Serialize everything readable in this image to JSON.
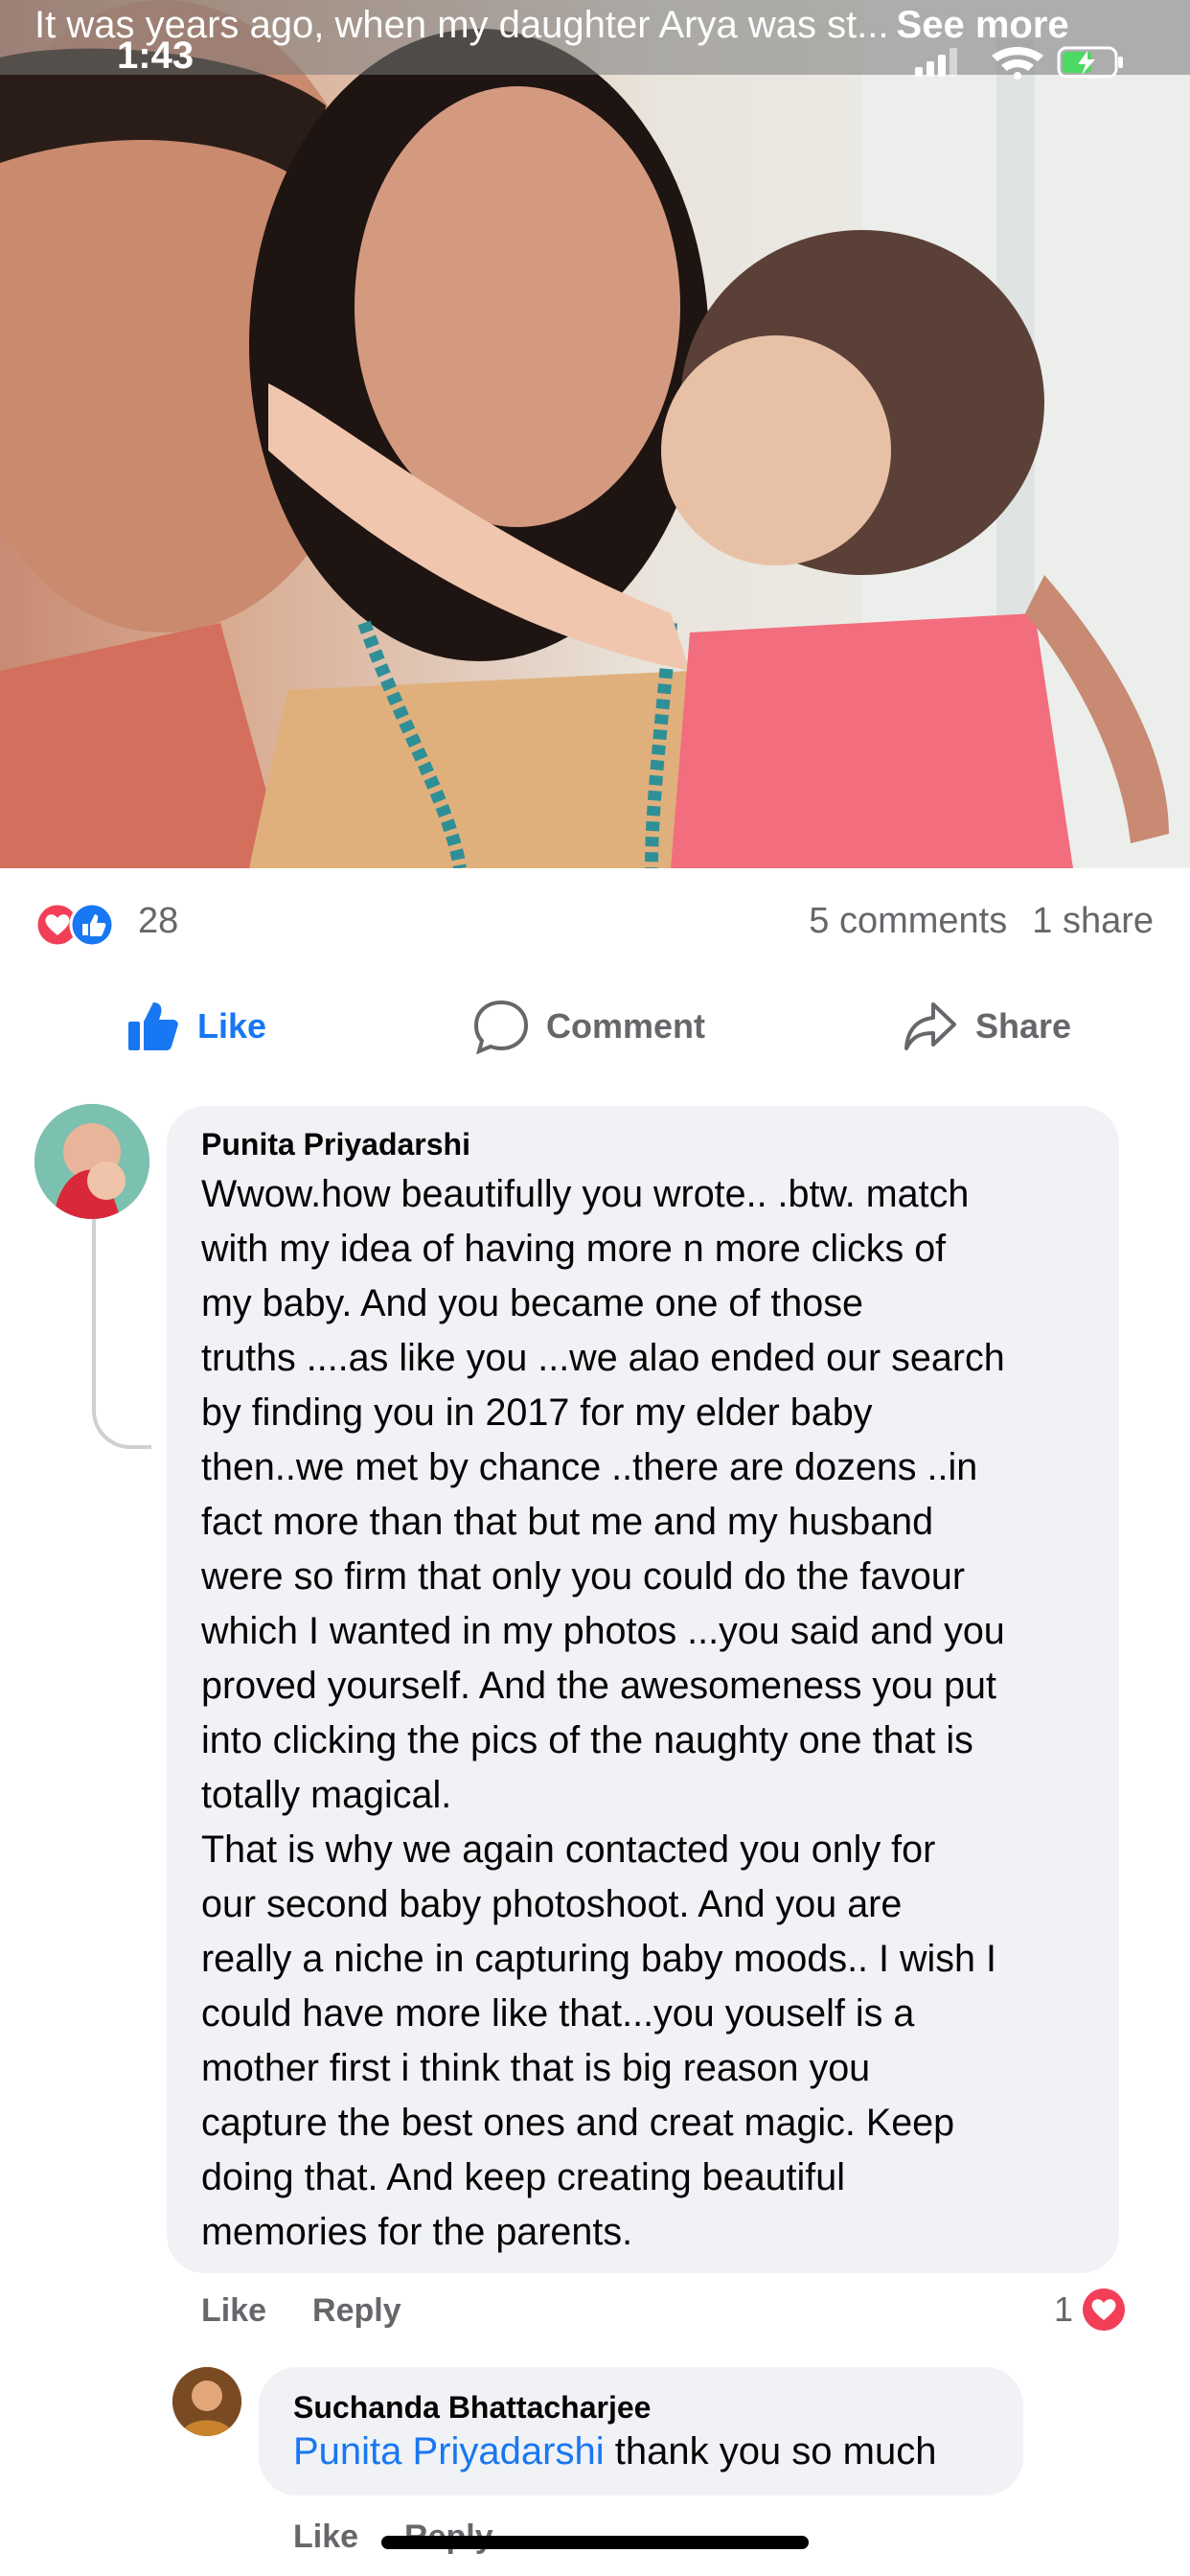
{
  "post": {
    "caption": "It was years ago, when my daughter Arya was st...",
    "see_more": "See more",
    "reaction_count": "28",
    "comments": "5 comments",
    "shares": "1 share"
  },
  "status_bar": {
    "time": "1:43"
  },
  "actions": {
    "like": "Like",
    "comment": "Comment",
    "share": "Share"
  },
  "comment1": {
    "author": "Punita Priyadarshi",
    "text": "Wwow.how beautifully you wrote.. .btw. match\nwith my idea of having more n more clicks of\nmy baby. And you became one of those\ntruths ....as like you ...we alao ended our search\nby finding you in 2017 for my elder baby\nthen..we met by chance ..there are dozens ..in\nfact more than that but me and my husband\nwere so firm that only you could do the favour\nwhich I wanted in my photos ...you said and you\nproved yourself. And the awesomeness you put\ninto clicking the pics of the naughty one that is\ntotally magical.\nThat is why we again contacted  you only for\nour second baby photoshoot. And you are\nreally a niche in capturing baby moods.. I wish I\ncould have more like that...you youself is a\nmother first i think that is big reason you\ncapture the best ones and creat magic. Keep\ndoing that. And keep creating beautiful\nmemories for the parents.",
    "like": "Like",
    "reply": "Reply",
    "reaction_count": "1"
  },
  "comment2": {
    "author": "Suchanda Bhattacharjee",
    "mention": "Punita Priyadarshi",
    "text": " thank you so much",
    "like": "Like",
    "reply": "Reply"
  },
  "colors": {
    "accent": "#1877f2",
    "love": "#f33e58",
    "muted": "#65676b",
    "bubble": "#f0f2f5"
  }
}
